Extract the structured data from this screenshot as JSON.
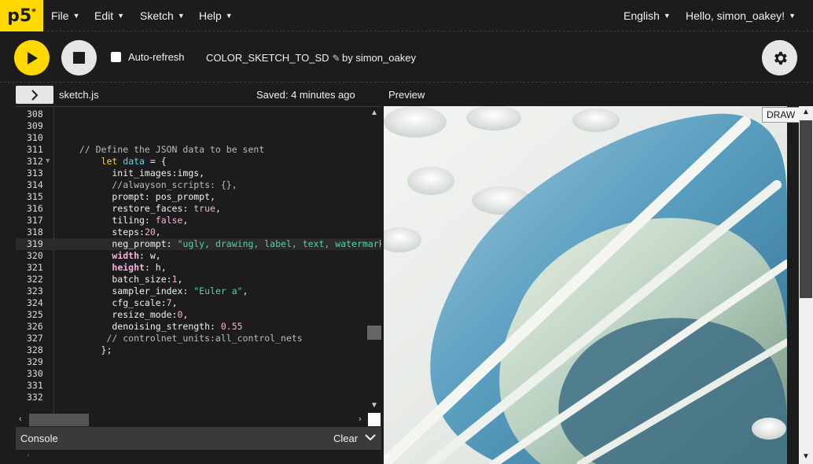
{
  "nav": {
    "logo": "p5",
    "logo_sup": "*",
    "menus": [
      "File",
      "Edit",
      "Sketch",
      "Help"
    ],
    "language": "English",
    "user": "Hello, simon_oakey!"
  },
  "toolbar": {
    "auto_refresh_label": "Auto-refresh",
    "sketch_name": "COLOR_SKETCH_TO_SD",
    "owner": "by simon_oakey"
  },
  "editor": {
    "file_name": "sketch.js",
    "saved_status": "Saved: 4 minutes ago",
    "preview_label": "Preview",
    "active_line": 319,
    "line_numbers": [
      "308",
      "309",
      "310",
      "311",
      "312",
      "313",
      "314",
      "315",
      "316",
      "317",
      "318",
      "319",
      "320",
      "321",
      "322",
      "323",
      "324",
      "325",
      "326",
      "327",
      "328",
      "329",
      "330",
      "331",
      "332"
    ],
    "lines": [
      "",
      "",
      "",
      "  // Define the JSON data to be sent",
      "      let data = {",
      "        init_images:imgs,",
      "        //alwayson_scripts: {},",
      "        prompt: pos_prompt,",
      "        restore_faces: true,",
      "        tiling: false,",
      "        steps:20,",
      "        neg_prompt: \"ugly, drawing, label, text, watermark,",
      "        width: w,",
      "        height: h,",
      "        batch_size:1,",
      "        sampler_index: \"Euler a\",",
      "        cfg_scale:7,",
      "        resize_mode:0,",
      "        denoising_strength: 0.55",
      "       // controlnet_units:all_control_nets",
      "      };",
      "",
      "",
      "",
      ""
    ]
  },
  "console": {
    "title": "Console",
    "clear_label": "Clear",
    "prompt": "›"
  },
  "preview": {
    "draw_button": "DRAW"
  },
  "colors": {
    "accent": "#ffd800",
    "background": "#1c1c1c",
    "console_bar": "#3a3a3a"
  }
}
